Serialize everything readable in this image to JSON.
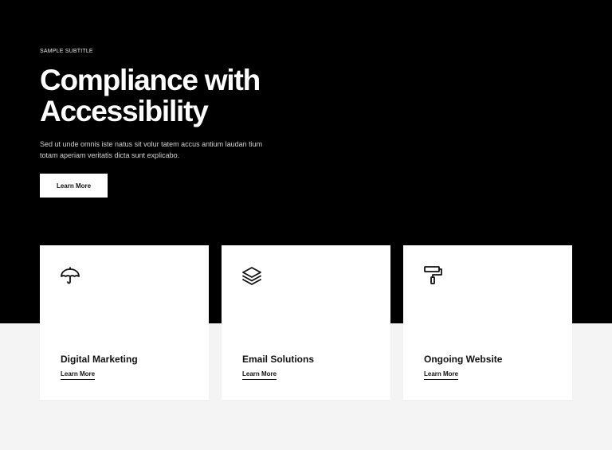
{
  "hero": {
    "subtitle": "SAMPLE SUBTITLE",
    "title_line1": "Compliance with",
    "title_line2": "Accessibility",
    "description": "Sed ut unde omnis iste natus sit volur tatem accus antium laudan tium totam aperiam veritatis dicta sunt explicabo.",
    "button_label": "Learn More"
  },
  "cards": [
    {
      "icon": "umbrella-icon",
      "title": "Digital Marketing",
      "link_label": "Learn More"
    },
    {
      "icon": "layers-icon",
      "title": "Email Solutions",
      "link_label": "Learn More"
    },
    {
      "icon": "paint-roller-icon",
      "title": "Ongoing Website",
      "link_label": "Learn More"
    }
  ],
  "colors": {
    "hero_background": "#000000",
    "page_background": "#f4f4f4",
    "card_background": "#ffffff",
    "text_dark": "#111111"
  }
}
